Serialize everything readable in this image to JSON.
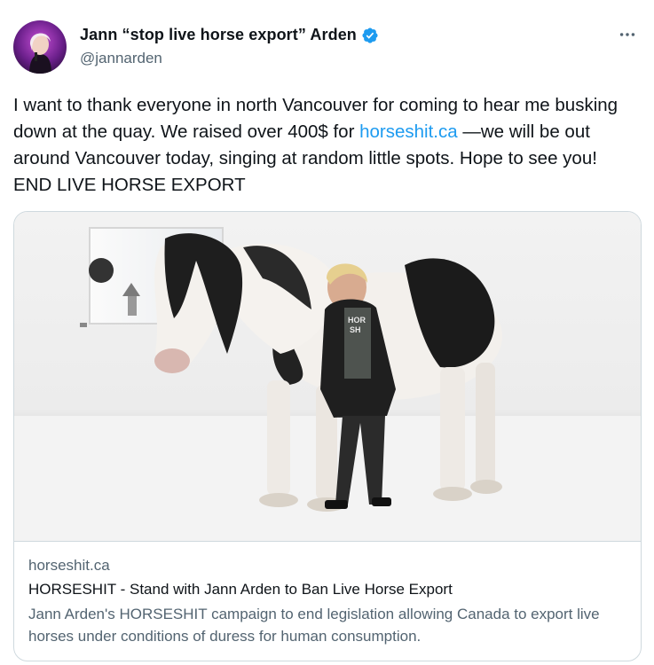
{
  "author": {
    "display_name": "Jann “stop live horse export” Arden",
    "handle": "@jannarden",
    "verified": true,
    "avatar_icon": "avatar-photo"
  },
  "tweet": {
    "text_before_link": "I want to thank everyone in north Vancouver for coming to hear me busking down at the quay. We raised over 400$ for ",
    "link_text": "horseshit.ca",
    "text_after_link": " —we will be out around Vancouver today, singing at random little spots. Hope to see you!  END LIVE HORSE EXPORT"
  },
  "card": {
    "domain": "horseshit.ca",
    "title": "HORSESHIT - Stand with Jann Arden to Ban Live Horse Export",
    "description": "Jann Arden's HORSESHIT campaign to end legislation allowing Canada to export live horses under conditions of duress for human consumption.",
    "image_text": "HORSE SHIT"
  },
  "colors": {
    "link": "#1d9bf0",
    "secondary_text": "#536471",
    "primary_text": "#0f1419",
    "verified_badge": "#1d9bf0",
    "border": "#cfd9de"
  },
  "icons": {
    "more": "more-horizontal-icon",
    "verified": "verified-badge-icon"
  }
}
